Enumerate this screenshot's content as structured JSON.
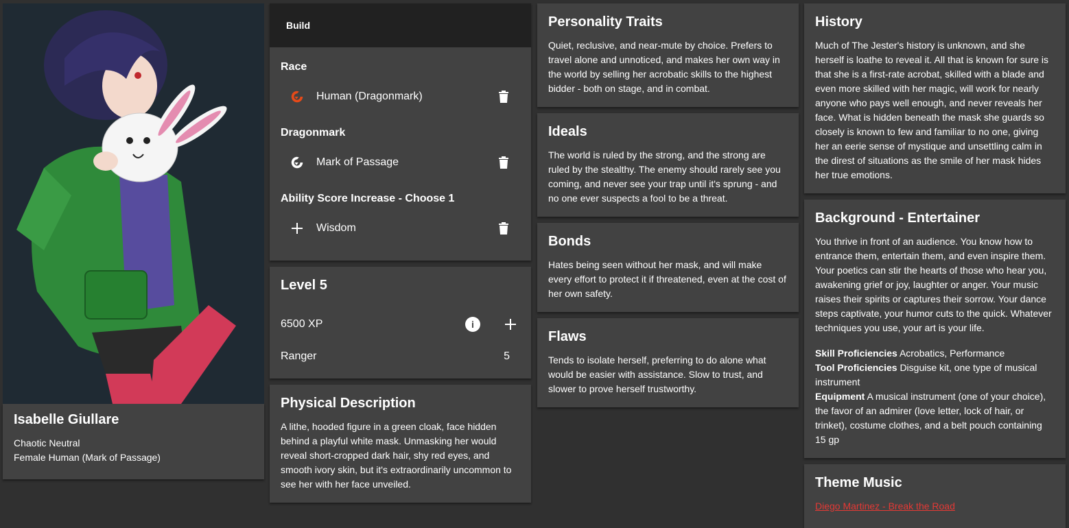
{
  "character": {
    "name": "Isabelle Giullare",
    "alignment": "Chaotic Neutral",
    "description_line": "Female Human (Mark of Passage)"
  },
  "build": {
    "header": "Build",
    "sections": [
      {
        "title": "Race",
        "item": {
          "label": "Human (Dragonmark)",
          "icon": "dragonmark-orange-icon",
          "action": "trash-icon"
        }
      },
      {
        "title": "Dragonmark",
        "item": {
          "label": "Mark of Passage",
          "icon": "dragonmark-white-icon",
          "action": "trash-icon"
        }
      },
      {
        "title": "Ability Score Increase - Choose 1",
        "item": {
          "label": "Wisdom",
          "icon": "plus-icon",
          "action": "trash-icon"
        }
      }
    ]
  },
  "level": {
    "title": "Level 5",
    "xp": "6500 XP",
    "class_name": "Ranger",
    "class_level": "5"
  },
  "physical": {
    "title": "Physical Description",
    "text": "A lithe, hooded figure in a green cloak, face hidden behind a playful white mask. Unmasking her would reveal short-cropped dark hair, shy red eyes, and smooth ivory skin, but it's extraordinarily uncommon to see her with her face unveiled."
  },
  "personality": {
    "title": "Personality Traits",
    "text": "Quiet, reclusive, and near-mute by choice. Prefers to travel alone and unnoticed, and makes her own way in the world by selling her acrobatic skills to the highest bidder - both on stage, and in combat."
  },
  "ideals": {
    "title": "Ideals",
    "text": "The world is ruled by the strong, and the strong are ruled by the stealthy. The enemy should rarely see you coming, and never see your trap until it's sprung - and no one ever suspects a fool to be a threat."
  },
  "bonds": {
    "title": "Bonds",
    "text": "Hates being seen without her mask, and will make every effort to protect it if threatened, even at the cost of her own safety."
  },
  "flaws": {
    "title": "Flaws",
    "text": "Tends to isolate herself, preferring to do alone what would be easier with assistance. Slow to trust, and slower to prove herself trustworthy."
  },
  "history": {
    "title": "History",
    "text": "Much of The Jester's history is unknown, and she herself is loathe to reveal it. All that is known for sure is that she is a first-rate acrobat, skilled with a blade and even more skilled with her magic, will work for nearly anyone who pays well enough, and never reveals her face. What is hidden beneath the mask she guards so closely is known to few and familiar to no one, giving her an eerie sense of mystique and unsettling calm in the direst of situations as the smile of her mask hides her true emotions."
  },
  "background": {
    "title": "Background - Entertainer",
    "text": "You thrive in front of an audience. You know how to entrance them, entertain them, and even inspire them. Your poetics can stir the hearts of those who hear you, awakening grief or joy, laughter or anger. Your music raises their spirits or captures their sorrow. Your dance steps captivate, your humor cuts to the quick. Whatever techniques you use, your art is your life.",
    "skill_label": "Skill Proficiencies",
    "skill_value": "Acrobatics, Performance",
    "tool_label": "Tool Proficiencies",
    "tool_value": "Disguise kit, one type of musical instrument",
    "equipment_label": "Equipment",
    "equipment_value": "A musical instrument (one of your choice), the favor of an admirer (love letter, lock of hair, or trinket), costume clothes, and a belt pouch containing 15 gp"
  },
  "music": {
    "title": "Theme Music",
    "link": "Diego Martinez - Break the Road"
  },
  "colors": {
    "background": "#303030",
    "card": "#424242",
    "header": "#212121",
    "accent_orange": "#e64a19",
    "link_red": "#e53935"
  }
}
